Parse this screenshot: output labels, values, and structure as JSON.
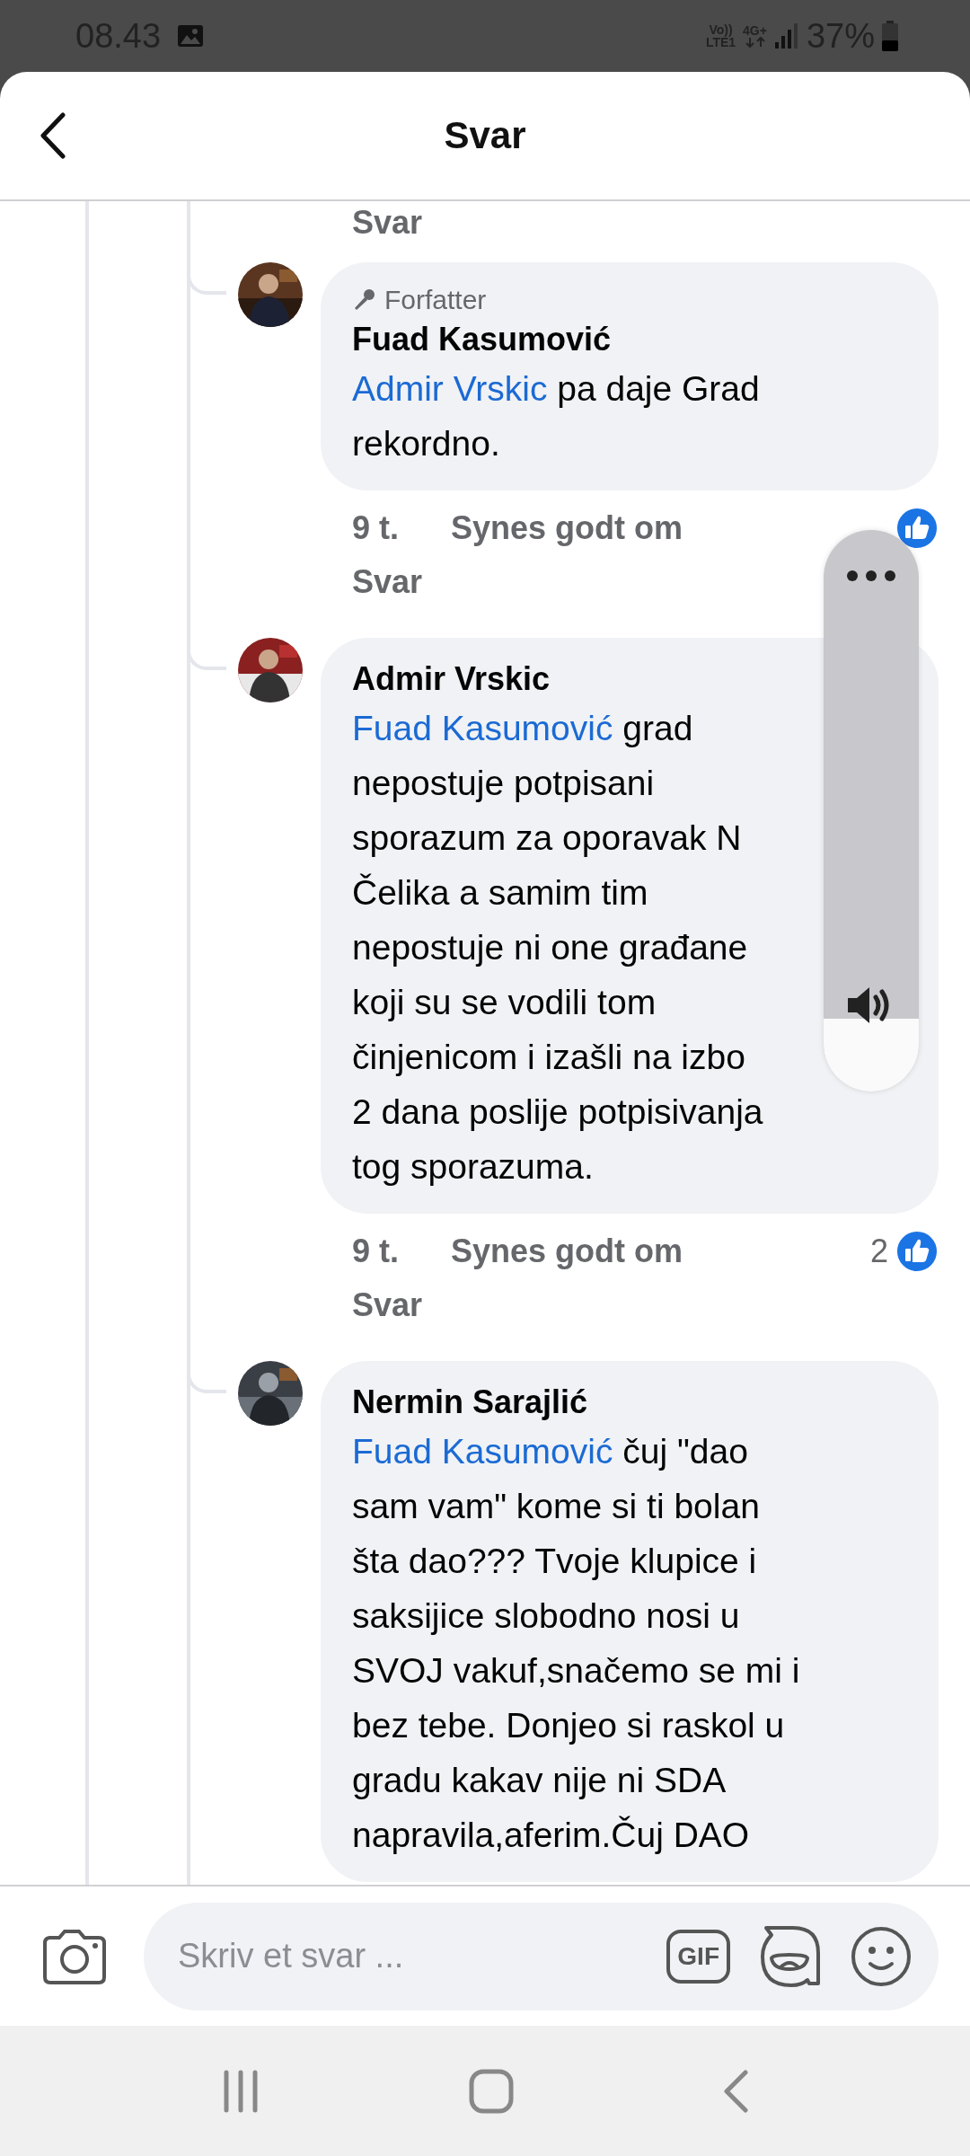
{
  "status_bar": {
    "time": "08.43",
    "volte": "Vo))",
    "lte": "LTE1",
    "network": "4G+",
    "battery": "37%"
  },
  "header": {
    "title": "Svar"
  },
  "thread": {
    "top_reply": "Svar",
    "comments": [
      {
        "author": "Fuad Kasumović",
        "badge": "Forfatter",
        "mention": "Admir Vrskic",
        "lines": [
          " pa daje Grad",
          "rekordno."
        ],
        "time": "9 t.",
        "like": "Synes godt om",
        "reply": "Svar"
      },
      {
        "author": "Admir Vrskic",
        "mention": "Fuad Kasumović",
        "lines": [
          " grad",
          "nepostuje potpisani",
          "sporazum za oporavak N",
          "Čelika a samim tim",
          "nepostuje ni one građane",
          "koji su se vodili tom",
          "činjenicom i izašli na izbo",
          "2 dana poslije potpisivanja",
          "tog sporazuma."
        ],
        "time": "9 t.",
        "like": "Synes godt om",
        "reply": "Svar",
        "likes": "2"
      },
      {
        "author": "Nermin Sarajlić",
        "mention": "Fuad Kasumović",
        "lines": [
          " čuj \"dao",
          "sam vam\" kome si ti bolan",
          "šta dao??? Tvoje klupice i",
          "saksijice slobodno nosi u",
          "SVOJ vakuf,snačemo se mi i",
          "bez tebe. Donjeo si raskol u",
          "gradu kakav nije ni SDA",
          "napravila,aferim.Čuj DAO"
        ]
      }
    ]
  },
  "volume": {
    "level": 0.13
  },
  "composer": {
    "placeholder": "Skriv et svar ...",
    "gif": "GIF"
  }
}
